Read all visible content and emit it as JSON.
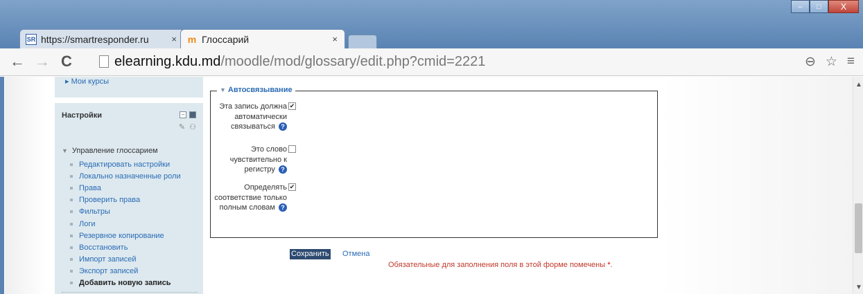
{
  "browser": {
    "tabs": [
      {
        "icon": "SR",
        "title": "https://smartresponder.ru",
        "close": "×"
      },
      {
        "icon": "m",
        "title": "Глоссарий",
        "close": "×"
      }
    ],
    "window_controls": [
      "–",
      "□",
      "X"
    ],
    "nav": {
      "back": "←",
      "forward": "→",
      "reload": "C"
    },
    "url": {
      "host": "elearning.kdu.md",
      "path": "/moodle/mod/glossary/edit.php?cmid=2221"
    },
    "toolbar_icons": [
      "zoom-icon",
      "star-icon",
      "menu-icon"
    ],
    "toolbar_glyphs": {
      "zoom": "⊖",
      "star": "☆",
      "menu": "≡"
    }
  },
  "sidebar": {
    "my_courses": "Мои курсы",
    "settings_title": "Настройки",
    "tree_root": "Управление глоссарием",
    "items": [
      {
        "label": "Редактировать настройки"
      },
      {
        "label": "Локально назначенные роли"
      },
      {
        "label": "Права"
      },
      {
        "label": "Проверить права"
      },
      {
        "label": "Фильтры"
      },
      {
        "label": "Логи"
      },
      {
        "label": "Резервное копирование"
      },
      {
        "label": "Восстановить"
      },
      {
        "label": "Импорт записей"
      },
      {
        "label": "Экспорт записей"
      },
      {
        "label": "Добавить новую запись"
      }
    ]
  },
  "form": {
    "section_title": "Автосвязывание",
    "fields": [
      {
        "label": "Эта запись должна автоматически связываться",
        "checked": true
      },
      {
        "label": "Это слово чувствительно к регистру",
        "checked": false
      },
      {
        "label": "Определять соответствие только полным словам",
        "checked": true
      }
    ],
    "help_glyph": "?",
    "save_label": "Сохранить",
    "cancel_label": "Отмена",
    "required_note": "Обязательные для заполнения поля в этой форме помечены",
    "required_star": "*",
    "required_end": "."
  },
  "colors": {
    "link": "#2a6bb5",
    "required": "#c0392b",
    "block_bg": "#dde9ef",
    "save_bg": "#2d4a70"
  }
}
